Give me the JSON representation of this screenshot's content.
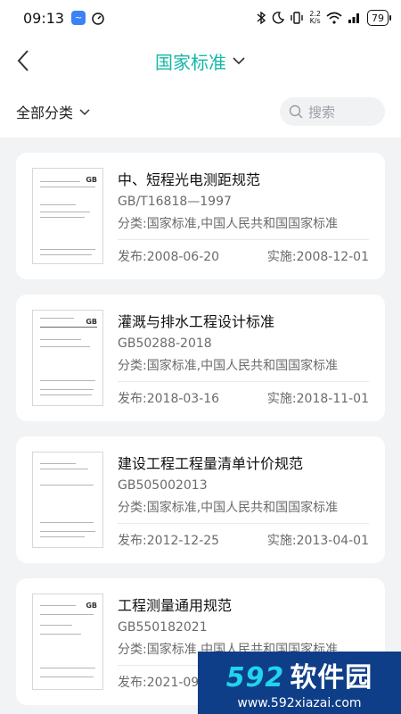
{
  "status": {
    "time": "09:13",
    "network_speed_top": "2.2",
    "network_speed_bottom": "K/s",
    "battery": "79"
  },
  "header": {
    "title": "国家标准"
  },
  "filter": {
    "category_label": "全部分类",
    "search_placeholder": "搜索"
  },
  "standards": [
    {
      "name": "中、短程光电测距规范",
      "code": "GB/T16818—1997",
      "category": "分类:国家标准,中国人民共和国国家标准",
      "publish": "发布:2008-06-20",
      "implement": "实施:2008-12-01"
    },
    {
      "name": "灌溉与排水工程设计标准",
      "code": "GB50288-2018",
      "category": "分类:国家标准,中国人民共和国国家标准",
      "publish": "发布:2018-03-16",
      "implement": "实施:2018-11-01"
    },
    {
      "name": "建设工程工程量清单计价规范",
      "code": "GB505002013",
      "category": "分类:国家标准,中国人民共和国国家标准",
      "publish": "发布:2012-12-25",
      "implement": "实施:2013-04-01"
    },
    {
      "name": "工程测量通用规范",
      "code": "GB550182021",
      "category": "分类:国家标准,中国人民共和国国家标准",
      "publish": "发布:2021-09-",
      "implement": ""
    }
  ],
  "watermark": {
    "brand_num": "592",
    "brand_text": "软件园",
    "url": "www.592xiazai.com"
  },
  "colors": {
    "accent": "#14b8a6",
    "background": "#f2f3f5",
    "watermark_bg": "#0f3e88"
  }
}
